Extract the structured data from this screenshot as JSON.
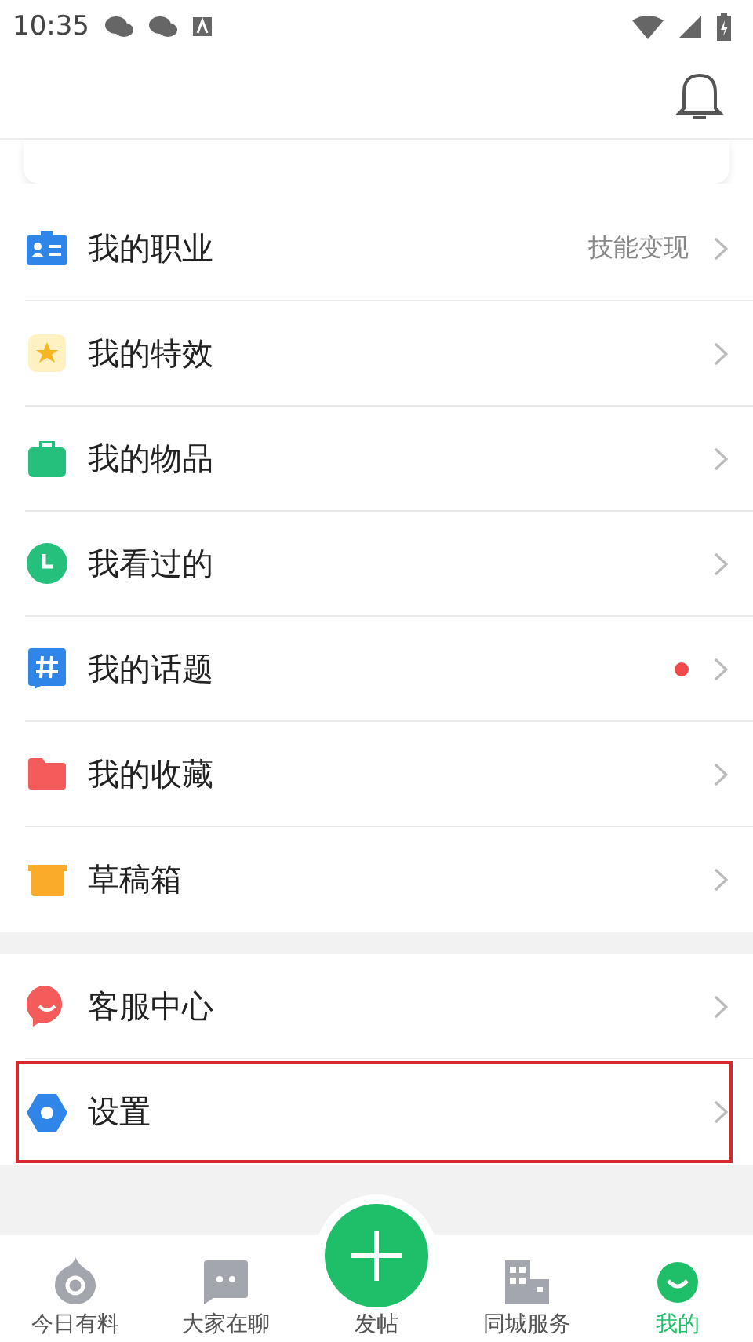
{
  "status_bar": {
    "time": "10:35"
  },
  "sections": [
    {
      "items": [
        {
          "label": "我的职业",
          "value": "技能变现",
          "unread": false,
          "highlighted": false
        },
        {
          "label": "我的特效",
          "unread": false,
          "highlighted": false
        },
        {
          "label": "我的物品",
          "unread": false,
          "highlighted": false
        },
        {
          "label": "我看过的",
          "unread": false,
          "highlighted": false
        },
        {
          "label": "我的话题",
          "unread": true,
          "highlighted": false
        },
        {
          "label": "我的收藏",
          "unread": false,
          "highlighted": false
        },
        {
          "label": "草稿箱",
          "unread": false,
          "highlighted": false
        }
      ]
    },
    {
      "items": [
        {
          "label": "客服中心",
          "unread": false,
          "highlighted": false
        },
        {
          "label": "设置",
          "unread": false,
          "highlighted": true
        }
      ]
    }
  ],
  "bottom_nav": [
    {
      "kind": "tab",
      "label": "今日有料",
      "selected": false
    },
    {
      "kind": "tab",
      "label": "大家在聊",
      "selected": false
    },
    {
      "kind": "post",
      "label": "发帖",
      "selected": false
    },
    {
      "kind": "tab",
      "label": "同城服务",
      "selected": false
    },
    {
      "kind": "tab",
      "label": "我的",
      "selected": true
    }
  ]
}
